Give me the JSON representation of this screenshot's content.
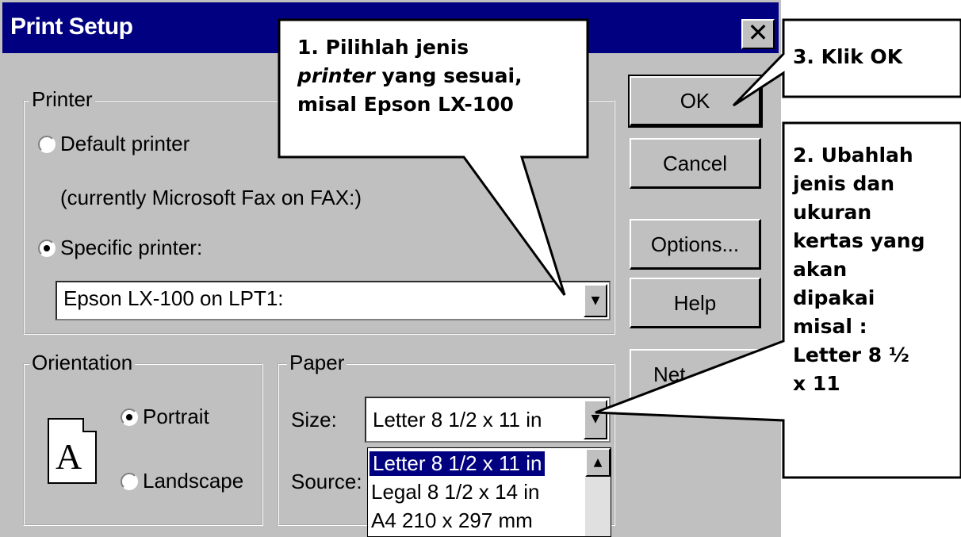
{
  "dialog": {
    "title": "Print Setup",
    "close_glyph": "✕",
    "printer_group": {
      "legend": "Printer",
      "default_printer_label": "Default printer",
      "default_printer_note": "(currently Microsoft Fax on FAX:)",
      "specific_printer_label": "Specific printer:",
      "selected_option": "Specific printer",
      "printer_select_value": "Epson LX-100 on LPT1:"
    },
    "orientation_group": {
      "legend": "Orientation",
      "portrait_label": "Portrait",
      "landscape_label": "Landscape",
      "selected_option": "Portrait",
      "page_icon_letter": "A"
    },
    "paper_group": {
      "legend": "Paper",
      "size_label": "Size:",
      "source_label": "Source:",
      "size_value": "Letter 8 1/2 x 11 in",
      "size_options": [
        "Letter 8 1/2 x 11 in",
        "Legal 8 1/2 x 14 in",
        "A4 210 x 297 mm"
      ],
      "highlighted_option": "Letter 8 1/2 x 11 in"
    },
    "buttons": {
      "ok": "OK",
      "cancel": "Cancel",
      "options": "Options...",
      "help": "Help",
      "network": "Net"
    }
  },
  "callouts": {
    "callout1_num": "1.",
    "callout1_line1": "Pilihlah jenis",
    "callout1_italic": "printer",
    "callout1_line2": "yang sesuai,",
    "callout1_line3": "misal Epson LX-100",
    "callout2_lines": [
      "2. Ubahlah",
      "jenis dan",
      "ukuran",
      "kertas yang",
      "akan",
      "dipakai",
      "misal :",
      "Letter 8 ½",
      "x 11"
    ],
    "callout3": "3. Klik OK"
  },
  "icons": {
    "close": "close-icon",
    "dropdown": "chevron-down-icon",
    "scroll_up": "scroll-up-icon",
    "page": "portrait-page-icon"
  },
  "colors": {
    "titlebar": "#000080",
    "dialog_face": "#c0c0c0",
    "selection": "#000080"
  }
}
